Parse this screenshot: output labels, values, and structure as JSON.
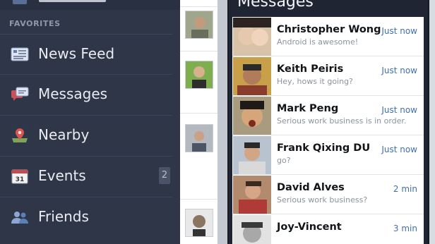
{
  "sidebar": {
    "section_label": "FAVORITES",
    "items": [
      {
        "label": "News Feed",
        "icon": "news-feed-icon"
      },
      {
        "label": "Messages",
        "icon": "messages-icon"
      },
      {
        "label": "Nearby",
        "icon": "nearby-pin-icon"
      },
      {
        "label": "Events",
        "icon": "calendar-icon",
        "badge": "2",
        "icon_text": "31"
      },
      {
        "label": "Friends",
        "icon": "friends-icon"
      }
    ]
  },
  "panel": {
    "title": "Messages",
    "messages": [
      {
        "name": "Christopher Wong",
        "preview": "Android is awesome!",
        "time": "Just now"
      },
      {
        "name": "Keith Peiris",
        "preview": "Hey, hows it going?",
        "time": "Just now"
      },
      {
        "name": "Mark Peng",
        "preview": "Serious work business is in order.",
        "time": "Just now"
      },
      {
        "name": "Frank Qixing DU",
        "preview": "go?",
        "time": "Just now"
      },
      {
        "name": "David Alves",
        "preview": "Serious work business?",
        "time": "2 min"
      },
      {
        "name": "Joy-Vincent",
        "preview": "",
        "time": "3 min"
      }
    ]
  },
  "colors": {
    "sidebar_bg": "#2e3648",
    "panel_bg": "#1f2533",
    "time_blue": "#3e6fb5"
  }
}
